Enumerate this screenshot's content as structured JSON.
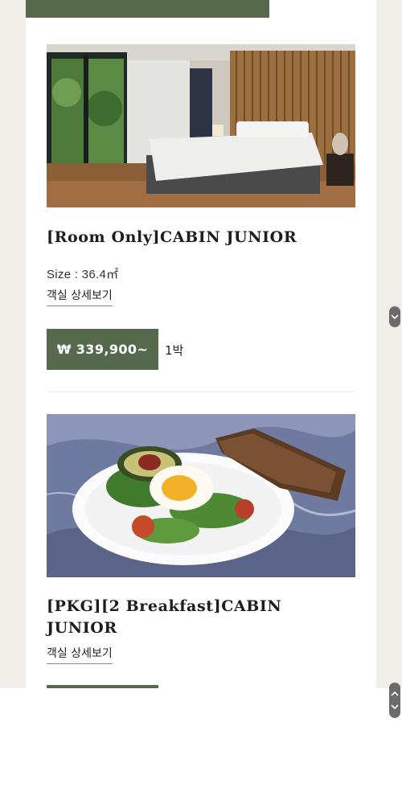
{
  "rooms": [
    {
      "title": "[Room Only]CABIN JUNIOR",
      "size": "Size : 36.4㎡",
      "detail_link": "객실 상세보기",
      "price": "₩ 339,900~",
      "nights": "1박"
    },
    {
      "title": "[PKG][2 Breakfast]CABIN JUNIOR",
      "detail_link": "객실 상세보기"
    }
  ],
  "colors": {
    "accent_green": "#56694c",
    "page_background": "#f1ede8",
    "panel_background": "#ffffff"
  },
  "icons": {
    "scroll_small": "chevron-down-icon",
    "scroll_large": "chevron-up-down-icon"
  }
}
